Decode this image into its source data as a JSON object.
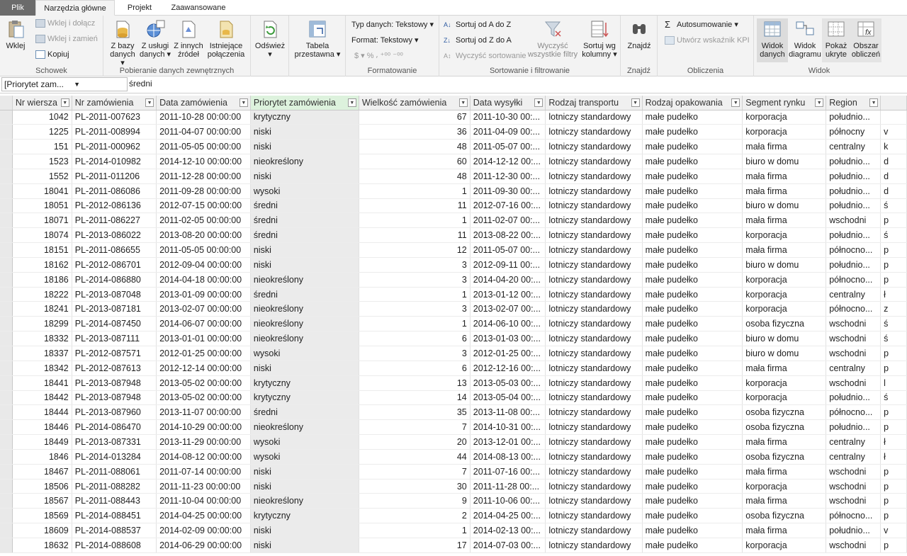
{
  "tabs": {
    "file": "Plik",
    "home": "Narzędzia główne",
    "project": "Projekt",
    "advanced": "Zaawansowane"
  },
  "ribbon": {
    "clipboard": {
      "label": "Schowek",
      "paste": "Wklej",
      "paste_append": "Wklej i dołącz",
      "paste_replace": "Wklej i zamień",
      "copy": "Kopiuj"
    },
    "external": {
      "label": "Pobieranie danych zewnętrznych",
      "from_db": "Z bazy",
      "from_db2": "danych ▾",
      "from_service": "Z usługi",
      "from_service2": "danych ▾",
      "from_other": "Z innych",
      "from_other2": "źródeł",
      "existing": "Istniejące",
      "existing2": "połączenia"
    },
    "refresh": {
      "label1": "Odśwież",
      "label2": "▾"
    },
    "pivot": {
      "label1": "Tabela",
      "label2": "przestawna ▾"
    },
    "format": {
      "label": "Formatowanie",
      "data_type": "Typ danych: Tekstowy ▾",
      "format": "Format: Tekstowy ▾",
      "symbols": "$ ▾ % ⸴ ⁺⁰⁰ ⁻⁰⁰"
    },
    "sort": {
      "label": "Sortowanie i filtrowanie",
      "az": "Sortuj od A do Z",
      "za": "Sortuj od Z do A",
      "clear_sort": "Wyczyść sortowanie",
      "clear_filters1": "Wyczyść",
      "clear_filters2": "wszystkie filtry",
      "sort_by1": "Sortuj wg",
      "sort_by2": "kolumny ▾"
    },
    "find": {
      "label": "Znajdź",
      "button": "Znajdź"
    },
    "calc": {
      "label": "Obliczenia",
      "autosum": "Autosumowanie ▾",
      "kpi": "Utwórz wskaźnik KPI"
    },
    "view": {
      "label": "Widok",
      "data1": "Widok",
      "data2": "danych",
      "diagram1": "Widok",
      "diagram2": "diagramu",
      "hidden1": "Pokaż",
      "hidden2": "ukryte",
      "calc1": "Obszar",
      "calc2": "obliczeń"
    }
  },
  "formula": {
    "name_box": "[Priorytet zam...",
    "value": "średni"
  },
  "columns": [
    "Nr wiersza",
    "Nr zamówienia",
    "Data zamówienia",
    "Priorytet zamówienia",
    "Wielkość zamówienia",
    "Data wysyłki",
    "Rodzaj transportu",
    "Rodzaj opakowania",
    "Segment rynku",
    "Region",
    ""
  ],
  "rows": [
    [
      "1042",
      "PL-2011-007623",
      "2011-10-28 00:00:00",
      "krytyczny",
      "67",
      "2011-10-30 00:...",
      "lotniczy standardowy",
      "małe pudełko",
      "korporacja",
      "południo...",
      ""
    ],
    [
      "1225",
      "PL-2011-008994",
      "2011-04-07 00:00:00",
      "niski",
      "36",
      "2011-04-09 00:...",
      "lotniczy standardowy",
      "małe pudełko",
      "korporacja",
      "północny",
      "v"
    ],
    [
      "151",
      "PL-2011-000962",
      "2011-05-05 00:00:00",
      "niski",
      "48",
      "2011-05-07 00:...",
      "lotniczy standardowy",
      "małe pudełko",
      "mała firma",
      "centralny",
      "k"
    ],
    [
      "1523",
      "PL-2014-010982",
      "2014-12-10 00:00:00",
      "nieokreślony",
      "60",
      "2014-12-12 00:...",
      "lotniczy standardowy",
      "małe pudełko",
      "biuro w domu",
      "południo...",
      "d"
    ],
    [
      "1552",
      "PL-2011-011206",
      "2011-12-28 00:00:00",
      "niski",
      "48",
      "2011-12-30 00:...",
      "lotniczy standardowy",
      "małe pudełko",
      "mała firma",
      "południo...",
      "d"
    ],
    [
      "18041",
      "PL-2011-086086",
      "2011-09-28 00:00:00",
      "wysoki",
      "1",
      "2011-09-30 00:...",
      "lotniczy standardowy",
      "małe pudełko",
      "mała firma",
      "południo...",
      "d"
    ],
    [
      "18051",
      "PL-2012-086136",
      "2012-07-15 00:00:00",
      "średni",
      "11",
      "2012-07-16 00:...",
      "lotniczy standardowy",
      "małe pudełko",
      "biuro w domu",
      "południo...",
      "ś"
    ],
    [
      "18071",
      "PL-2011-086227",
      "2011-02-05 00:00:00",
      "średni",
      "1",
      "2011-02-07 00:...",
      "lotniczy standardowy",
      "małe pudełko",
      "mała firma",
      "wschodni",
      "p"
    ],
    [
      "18074",
      "PL-2013-086022",
      "2013-08-20 00:00:00",
      "średni",
      "11",
      "2013-08-22 00:...",
      "lotniczy standardowy",
      "małe pudełko",
      "korporacja",
      "południo...",
      "ś"
    ],
    [
      "18151",
      "PL-2011-086655",
      "2011-05-05 00:00:00",
      "niski",
      "12",
      "2011-05-07 00:...",
      "lotniczy standardowy",
      "małe pudełko",
      "mała firma",
      "północno...",
      "p"
    ],
    [
      "18162",
      "PL-2012-086701",
      "2012-09-04 00:00:00",
      "niski",
      "3",
      "2012-09-11 00:...",
      "lotniczy standardowy",
      "małe pudełko",
      "biuro w domu",
      "południo...",
      "p"
    ],
    [
      "18186",
      "PL-2014-086880",
      "2014-04-18 00:00:00",
      "nieokreślony",
      "3",
      "2014-04-20 00:...",
      "lotniczy standardowy",
      "małe pudełko",
      "korporacja",
      "północno...",
      "p"
    ],
    [
      "18222",
      "PL-2013-087048",
      "2013-01-09 00:00:00",
      "średni",
      "1",
      "2013-01-12 00:...",
      "lotniczy standardowy",
      "małe pudełko",
      "korporacja",
      "centralny",
      "ł"
    ],
    [
      "18241",
      "PL-2013-087181",
      "2013-02-07 00:00:00",
      "nieokreślony",
      "3",
      "2013-02-07 00:...",
      "lotniczy standardowy",
      "małe pudełko",
      "korporacja",
      "północno...",
      "z"
    ],
    [
      "18299",
      "PL-2014-087450",
      "2014-06-07 00:00:00",
      "nieokreślony",
      "1",
      "2014-06-10 00:...",
      "lotniczy standardowy",
      "małe pudełko",
      "osoba fizyczna",
      "wschodni",
      "ś"
    ],
    [
      "18332",
      "PL-2013-087111",
      "2013-01-01 00:00:00",
      "nieokreślony",
      "6",
      "2013-01-03 00:...",
      "lotniczy standardowy",
      "małe pudełko",
      "biuro w domu",
      "wschodni",
      "ś"
    ],
    [
      "18337",
      "PL-2012-087571",
      "2012-01-25 00:00:00",
      "wysoki",
      "3",
      "2012-01-25 00:...",
      "lotniczy standardowy",
      "małe pudełko",
      "biuro w domu",
      "wschodni",
      "p"
    ],
    [
      "18342",
      "PL-2012-087613",
      "2012-12-14 00:00:00",
      "niski",
      "6",
      "2012-12-16 00:...",
      "lotniczy standardowy",
      "małe pudełko",
      "mała firma",
      "centralny",
      "p"
    ],
    [
      "18441",
      "PL-2013-087948",
      "2013-05-02 00:00:00",
      "krytyczny",
      "13",
      "2013-05-03 00:...",
      "lotniczy standardowy",
      "małe pudełko",
      "korporacja",
      "wschodni",
      "l"
    ],
    [
      "18442",
      "PL-2013-087948",
      "2013-05-02 00:00:00",
      "krytyczny",
      "14",
      "2013-05-04 00:...",
      "lotniczy standardowy",
      "małe pudełko",
      "korporacja",
      "południo...",
      "ś"
    ],
    [
      "18444",
      "PL-2013-087960",
      "2013-11-07 00:00:00",
      "średni",
      "35",
      "2013-11-08 00:...",
      "lotniczy standardowy",
      "małe pudełko",
      "osoba fizyczna",
      "północno...",
      "p"
    ],
    [
      "18446",
      "PL-2014-086470",
      "2014-10-29 00:00:00",
      "nieokreślony",
      "7",
      "2014-10-31 00:...",
      "lotniczy standardowy",
      "małe pudełko",
      "osoba fizyczna",
      "południo...",
      "p"
    ],
    [
      "18449",
      "PL-2013-087331",
      "2013-11-29 00:00:00",
      "wysoki",
      "20",
      "2013-12-01 00:...",
      "lotniczy standardowy",
      "małe pudełko",
      "mała firma",
      "centralny",
      "ł"
    ],
    [
      "1846",
      "PL-2014-013284",
      "2014-08-12 00:00:00",
      "wysoki",
      "44",
      "2014-08-13 00:...",
      "lotniczy standardowy",
      "małe pudełko",
      "osoba fizyczna",
      "centralny",
      "ł"
    ],
    [
      "18467",
      "PL-2011-088061",
      "2011-07-14 00:00:00",
      "niski",
      "7",
      "2011-07-16 00:...",
      "lotniczy standardowy",
      "małe pudełko",
      "mała firma",
      "wschodni",
      "p"
    ],
    [
      "18506",
      "PL-2011-088282",
      "2011-11-23 00:00:00",
      "niski",
      "30",
      "2011-11-28 00:...",
      "lotniczy standardowy",
      "małe pudełko",
      "korporacja",
      "wschodni",
      "p"
    ],
    [
      "18567",
      "PL-2011-088443",
      "2011-10-04 00:00:00",
      "nieokreślony",
      "9",
      "2011-10-06 00:...",
      "lotniczy standardowy",
      "małe pudełko",
      "mała firma",
      "wschodni",
      "p"
    ],
    [
      "18569",
      "PL-2014-088451",
      "2014-04-25 00:00:00",
      "krytyczny",
      "2",
      "2014-04-25 00:...",
      "lotniczy standardowy",
      "małe pudełko",
      "osoba fizyczna",
      "północno...",
      "p"
    ],
    [
      "18609",
      "PL-2014-088537",
      "2014-02-09 00:00:00",
      "niski",
      "1",
      "2014-02-13 00:...",
      "lotniczy standardowy",
      "małe pudełko",
      "mała firma",
      "południo...",
      "v"
    ],
    [
      "18632",
      "PL-2014-088608",
      "2014-06-29 00:00:00",
      "niski",
      "17",
      "2014-07-03 00:...",
      "lotniczy standardowy",
      "małe pudełko",
      "korporacja",
      "wschodni",
      "p"
    ]
  ]
}
